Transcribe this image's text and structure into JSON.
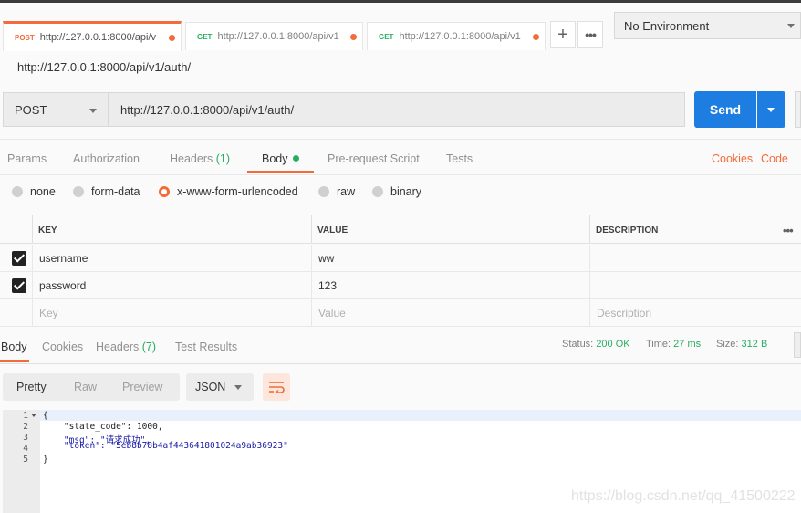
{
  "tabs": [
    {
      "method": "POST",
      "method_color": "#f26b3a",
      "url": "http://127.0.0.1:8000/api/v",
      "active": true
    },
    {
      "method": "GET",
      "method_color": "#27ae60",
      "url": "http://127.0.0.1:8000/api/v1",
      "active": false
    },
    {
      "method": "GET",
      "method_color": "#27ae60",
      "url": "http://127.0.0.1:8000/api/v1",
      "active": false
    }
  ],
  "tab_controls": {
    "add_label": "+",
    "more_label": "•••"
  },
  "environment": {
    "selected": "No Environment"
  },
  "request": {
    "title": "http://127.0.0.1:8000/api/v1/auth/",
    "method": "POST",
    "url": "http://127.0.0.1:8000/api/v1/auth/",
    "send_label": "Send"
  },
  "request_tabs": {
    "params": "Params",
    "authorization": "Authorization",
    "headers": "Headers",
    "headers_count": "(1)",
    "body": "Body",
    "prerequest": "Pre-request Script",
    "tests": "Tests",
    "cookies_link": "Cookies",
    "code_link": "Code"
  },
  "body_types": {
    "none": "none",
    "form_data": "form-data",
    "urlencoded": "x-www-form-urlencoded",
    "raw": "raw",
    "binary": "binary",
    "selected": "x-www-form-urlencoded"
  },
  "kv_table": {
    "headers": {
      "key": "KEY",
      "value": "VALUE",
      "description": "DESCRIPTION"
    },
    "rows": [
      {
        "key": "username",
        "value": "ww",
        "description": "",
        "checked": true
      },
      {
        "key": "password",
        "value": "123",
        "description": "",
        "checked": true
      }
    ],
    "placeholder": {
      "key": "Key",
      "value": "Value",
      "description": "Description"
    }
  },
  "response_tabs": {
    "body": "Body",
    "cookies": "Cookies",
    "headers": "Headers",
    "headers_count": "(7)",
    "test_results": "Test Results"
  },
  "response_status": {
    "status_label": "Status:",
    "status_value": "200 OK",
    "time_label": "Time:",
    "time_value": "27 ms",
    "size_label": "Size:",
    "size_value": "312 B"
  },
  "view_toolbar": {
    "pretty": "Pretty",
    "raw": "Raw",
    "preview": "Preview",
    "format": "JSON"
  },
  "response_body": {
    "line_numbers": [
      "1",
      "2",
      "3",
      "4",
      "5"
    ],
    "lines": [
      "{",
      "    \"state_code\": 1000,",
      "    \"msg\": \"请求成功\",",
      "    \"token\": \"5eb8b78b4af443641801024a9ab36923\"",
      "}"
    ]
  },
  "watermark": "https://blog.csdn.net/qq_41500222",
  "colors": {
    "accent": "#f26b3a",
    "send": "#1e7de0",
    "ok": "#27ae60"
  }
}
